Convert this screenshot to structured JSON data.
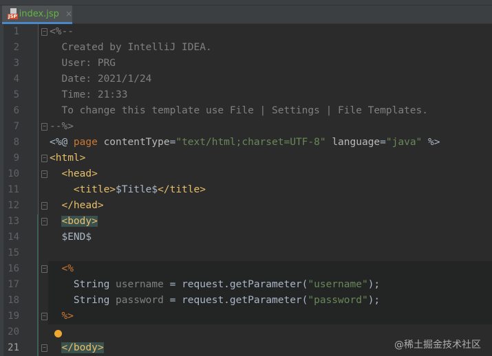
{
  "tab": {
    "label": "index.jsp",
    "icon_label": "JSP",
    "close": "×"
  },
  "current_line": 21,
  "injected_lines": [
    16,
    17,
    18,
    19
  ],
  "fold_lines": [
    1,
    7,
    9,
    10,
    12,
    13,
    16,
    19,
    21
  ],
  "lines": [
    [
      [
        "c",
        "<%--"
      ]
    ],
    [
      [
        "c",
        "  Created by IntelliJ IDEA."
      ]
    ],
    [
      [
        "c",
        "  User: PRG"
      ]
    ],
    [
      [
        "c",
        "  Date: 2021/1/24"
      ]
    ],
    [
      [
        "c",
        "  Time: 21:33"
      ]
    ],
    [
      [
        "c",
        "  To change this template use File | Settings | File Templates."
      ]
    ],
    [
      [
        "c",
        "--%>"
      ]
    ],
    [
      [
        "pl",
        "<%@ "
      ],
      [
        "kw",
        "page "
      ],
      [
        "attr",
        "contentType"
      ],
      [
        "pl",
        "="
      ],
      [
        "str",
        "\"text/html;charset=UTF-8\""
      ],
      [
        "pl",
        " "
      ],
      [
        "attr",
        "language"
      ],
      [
        "pl",
        "="
      ],
      [
        "str",
        "\"java\""
      ],
      [
        "pl",
        " %>"
      ]
    ],
    [
      [
        "tag",
        "<html>"
      ]
    ],
    [
      [
        "pl",
        "  "
      ],
      [
        "tag",
        "<head>"
      ]
    ],
    [
      [
        "pl",
        "    "
      ],
      [
        "tag",
        "<title>"
      ],
      [
        "pl",
        "$Title$"
      ],
      [
        "tag",
        "</title>"
      ]
    ],
    [
      [
        "pl",
        "  "
      ],
      [
        "tag",
        "</head>"
      ]
    ],
    [
      [
        "pl",
        "  "
      ],
      [
        "tagh",
        "<body>"
      ]
    ],
    [
      [
        "pl",
        "  $END$"
      ]
    ],
    [
      [
        "pl",
        ""
      ]
    ],
    [
      [
        "pl",
        "  "
      ],
      [
        "kw",
        "<%"
      ]
    ],
    [
      [
        "pl",
        "    String "
      ],
      [
        "var",
        "username"
      ],
      [
        "pl",
        " = request.getParameter("
      ],
      [
        "str",
        "\"username\""
      ],
      [
        "pl",
        ");"
      ]
    ],
    [
      [
        "pl",
        "    String "
      ],
      [
        "var",
        "password"
      ],
      [
        "pl",
        " = request.getParameter("
      ],
      [
        "str",
        "\"password\""
      ],
      [
        "pl",
        ");"
      ]
    ],
    [
      [
        "pl",
        "  "
      ],
      [
        "kw",
        "%>"
      ]
    ],
    [
      [
        "pl",
        ""
      ]
    ],
    [
      [
        "pl",
        "  "
      ],
      [
        "tagh",
        "</body>"
      ]
    ]
  ],
  "watermark": "@稀土掘金技术社区"
}
